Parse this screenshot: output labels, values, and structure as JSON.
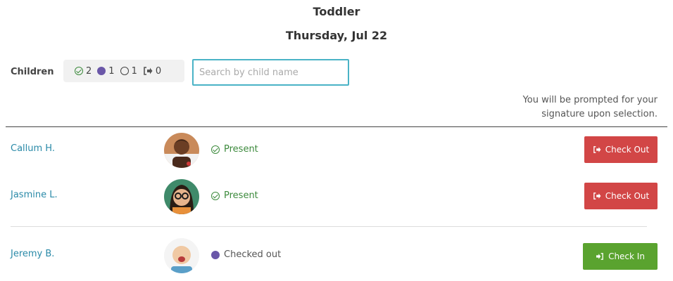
{
  "header": {
    "room": "Toddler",
    "date": "Thursday, Jul 22"
  },
  "filters": {
    "children_label": "Children",
    "counts": {
      "present": "2",
      "checked_out": "1",
      "absent": "1",
      "signed_out": "0"
    }
  },
  "search": {
    "placeholder": "Search by child name",
    "value": ""
  },
  "notice": {
    "line1": "You will be prompted for your",
    "line2": "signature upon selection."
  },
  "children": [
    {
      "name": "Callum H.",
      "status": "Present",
      "action": "Check Out"
    },
    {
      "name": "Jasmine L.",
      "status": "Present",
      "action": "Check Out"
    },
    {
      "name": "Jeremy B.",
      "status": "Checked out",
      "action": "Check In"
    }
  ],
  "colors": {
    "accent": "#4ab3c6",
    "present": "#3c8a3c",
    "checked_out": "#6a57a8",
    "check_out_button": "#d24646",
    "check_in_button": "#5aa32f",
    "name_link": "#2a8aa8"
  }
}
